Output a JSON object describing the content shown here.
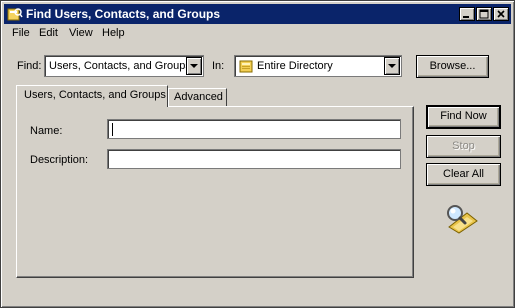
{
  "window": {
    "title": "Find Users, Contacts, and Groups"
  },
  "menu": [
    "File",
    "Edit",
    "View",
    "Help"
  ],
  "find": {
    "find_label": "Find:",
    "find_value": "Users, Contacts, and Groups",
    "in_label": "In:",
    "in_value": "Entire Directory",
    "browse_label": "Browse..."
  },
  "tabs": [
    "Users, Contacts, and Groups",
    "Advanced"
  ],
  "form": {
    "name_label": "Name:",
    "name_value": "",
    "description_label": "Description:",
    "description_value": ""
  },
  "actions": {
    "find_now": "Find Now",
    "stop": "Stop",
    "clear_all": "Clear All"
  },
  "colors": {
    "titlebar": "#0a246a",
    "face": "#d4d0c8"
  },
  "icons": {
    "app": "directory-search-icon",
    "directory": "directory-folder-icon",
    "search": "magnifier-search-icon"
  }
}
